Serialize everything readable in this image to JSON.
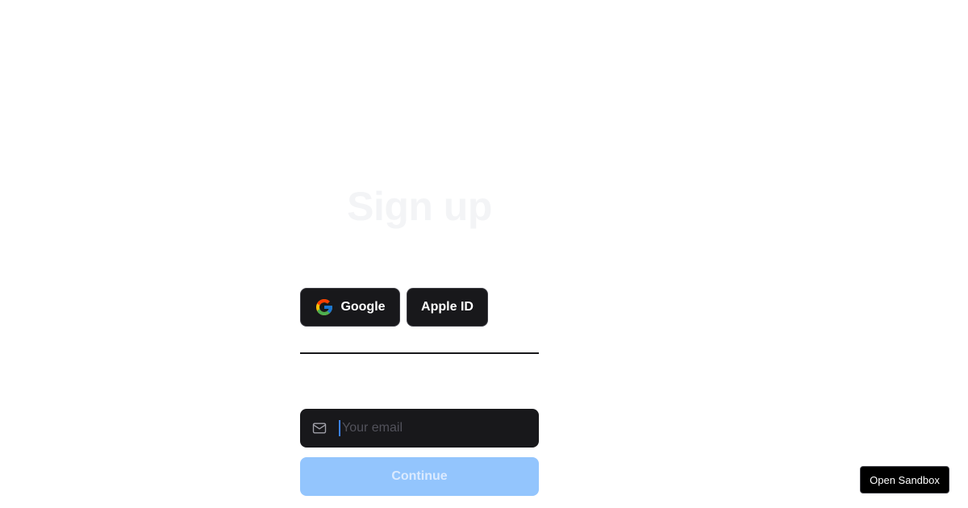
{
  "title": "Sign up",
  "social": {
    "google_label": "Google",
    "apple_label": "Apple ID"
  },
  "email": {
    "placeholder": "Your email",
    "value": ""
  },
  "continue_label": "Continue",
  "sandbox_label": "Open Sandbox",
  "colors": {
    "button_dark": "#18181b",
    "continue_disabled": "#93c5fd",
    "caret": "#3b82f6",
    "title_faint": "#f3f4f6"
  },
  "icons": {
    "google": "google-g-icon",
    "email": "mail-icon"
  }
}
